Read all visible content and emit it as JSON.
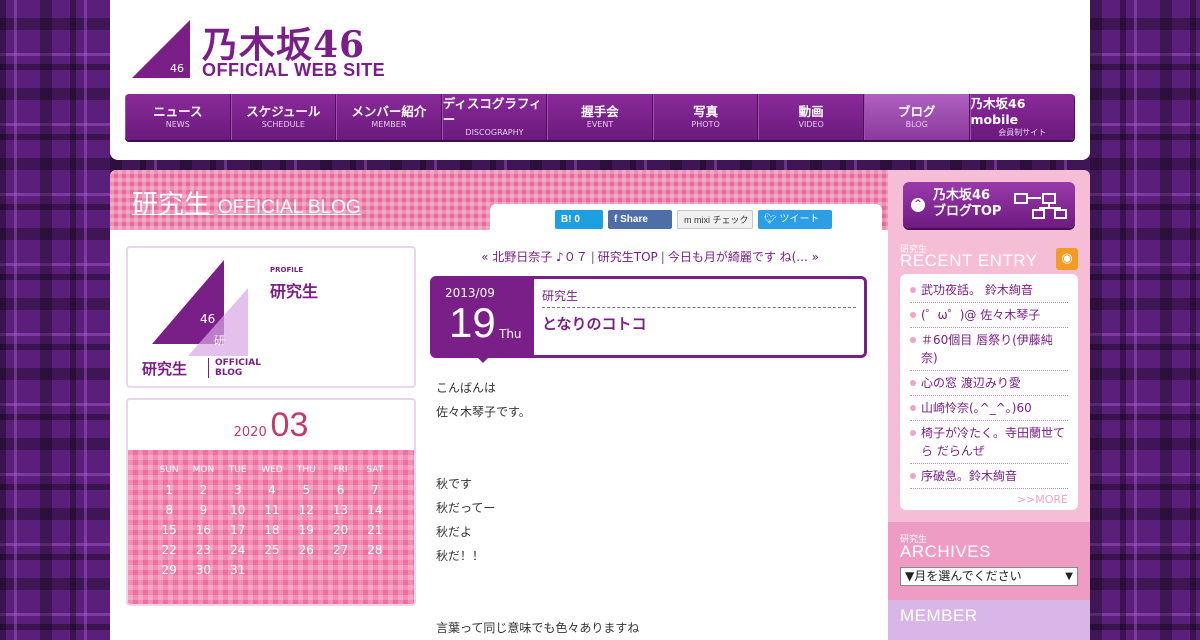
{
  "header": {
    "logo_jp": "乃木坂46",
    "logo_en": "OFFICIAL WEB SITE",
    "logo_badge": "46",
    "nav": [
      {
        "jp": "ニュース",
        "en": "NEWS"
      },
      {
        "jp": "スケジュール",
        "en": "SCHEDULE"
      },
      {
        "jp": "メンバー紹介",
        "en": "MEMBER"
      },
      {
        "jp": "ディスコグラフィー",
        "en": "DISCOGRAPHY"
      },
      {
        "jp": "握手会",
        "en": "EVENT"
      },
      {
        "jp": "写真",
        "en": "PHOTO"
      },
      {
        "jp": "動画",
        "en": "VIDEO"
      },
      {
        "jp": "ブログ",
        "en": "BLOG"
      },
      {
        "jp": "乃木坂46 mobile",
        "en": "会員制サイト"
      }
    ],
    "active_nav_index": 7
  },
  "blog": {
    "title_jp": "研究生",
    "title_en": "OFFICIAL BLOG"
  },
  "share": {
    "hatena": "B! 0",
    "facebook": "f Share",
    "mixi": "m mixi チェック",
    "twitter": "ツイート"
  },
  "profile": {
    "label": "PROFILE",
    "name": "研究生",
    "logo_jp": "研究生",
    "logo_en_1": "OFFICIAL",
    "logo_en_2": "BLOG",
    "logo_badge_46": "46",
    "logo_badge_ken": "研"
  },
  "calendar": {
    "year": "2020",
    "month": "03",
    "weekdays": [
      "SUN",
      "MON",
      "TUE",
      "WED",
      "THU",
      "FRI",
      "SAT"
    ],
    "weeks": [
      [
        "1",
        "2",
        "3",
        "4",
        "5",
        "6",
        "7"
      ],
      [
        "8",
        "9",
        "10",
        "11",
        "12",
        "13",
        "14"
      ],
      [
        "15",
        "16",
        "17",
        "18",
        "19",
        "20",
        "21"
      ],
      [
        "22",
        "23",
        "24",
        "25",
        "26",
        "27",
        "28"
      ],
      [
        "29",
        "30",
        "31",
        "",
        "",
        "",
        ""
      ]
    ]
  },
  "post_nav": {
    "prev": "« 北野日奈子 ♪０７",
    "top": "研究生TOP",
    "next": "今日も月が綺麗です ね(... »"
  },
  "post": {
    "year_month": "2013/09",
    "day": "19",
    "dow": "Thu",
    "author": "研究生",
    "title": "となりのコトコ",
    "lines": [
      "こんばんは",
      "佐々木琴子です。",
      "",
      "",
      "秋です",
      "秋だってー",
      "秋だよ",
      "秋だ！！",
      "",
      "",
      "言葉って同じ意味でも色々ありますね"
    ]
  },
  "sidebar": {
    "blog_top_line1": "乃木坂46",
    "blog_top_line2": "ブログTOP",
    "recent_small": "研究生",
    "recent_big": "RECENT ENTRY",
    "recent_items": [
      "武功夜話。 鈴木絢音",
      "(゜ω゜)@ 佐々木琴子",
      "＃60個目 唇祭り(伊藤純奈)",
      "心の窓 渡辺みり愛",
      "山崎怜奈(｡^_^｡)60",
      "椅子が冷たく。寺田蘭世てら だらんぜ",
      "序破急。鈴木絢音"
    ],
    "more": ">>MORE",
    "archives_small": "研究生",
    "archives_big": "ARCHIVES",
    "archives_select": "▼月を選んでください",
    "member_big": "MEMBER"
  },
  "colors": {
    "brand_purple": "#7b1f88",
    "pink": "#e86a9c",
    "sidebar_pink": "#f6bed6"
  }
}
